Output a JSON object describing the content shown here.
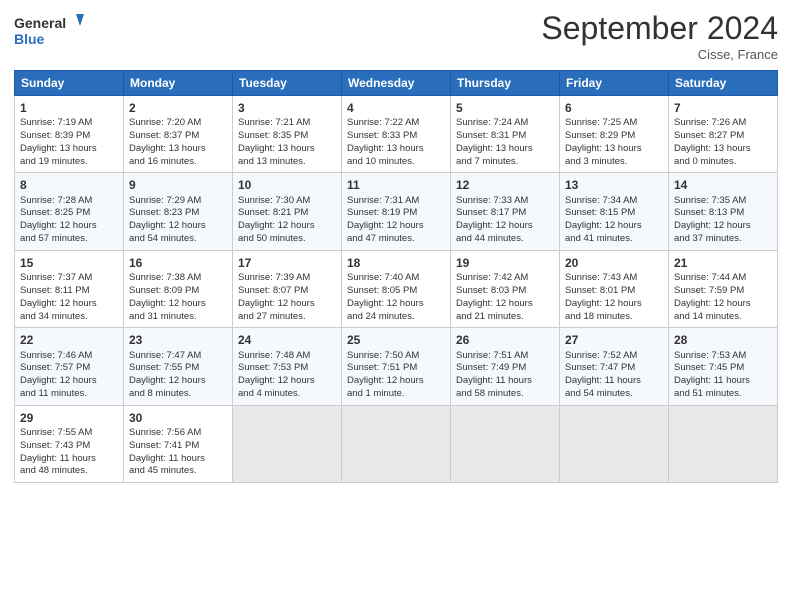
{
  "logo": {
    "line1": "General",
    "line2": "Blue"
  },
  "title": "September 2024",
  "subtitle": "Cisse, France",
  "days_header": [
    "Sunday",
    "Monday",
    "Tuesday",
    "Wednesday",
    "Thursday",
    "Friday",
    "Saturday"
  ],
  "weeks": [
    [
      {
        "num": "1",
        "lines": [
          "Sunrise: 7:19 AM",
          "Sunset: 8:39 PM",
          "Daylight: 13 hours",
          "and 19 minutes."
        ]
      },
      {
        "num": "2",
        "lines": [
          "Sunrise: 7:20 AM",
          "Sunset: 8:37 PM",
          "Daylight: 13 hours",
          "and 16 minutes."
        ]
      },
      {
        "num": "3",
        "lines": [
          "Sunrise: 7:21 AM",
          "Sunset: 8:35 PM",
          "Daylight: 13 hours",
          "and 13 minutes."
        ]
      },
      {
        "num": "4",
        "lines": [
          "Sunrise: 7:22 AM",
          "Sunset: 8:33 PM",
          "Daylight: 13 hours",
          "and 10 minutes."
        ]
      },
      {
        "num": "5",
        "lines": [
          "Sunrise: 7:24 AM",
          "Sunset: 8:31 PM",
          "Daylight: 13 hours",
          "and 7 minutes."
        ]
      },
      {
        "num": "6",
        "lines": [
          "Sunrise: 7:25 AM",
          "Sunset: 8:29 PM",
          "Daylight: 13 hours",
          "and 3 minutes."
        ]
      },
      {
        "num": "7",
        "lines": [
          "Sunrise: 7:26 AM",
          "Sunset: 8:27 PM",
          "Daylight: 13 hours",
          "and 0 minutes."
        ]
      }
    ],
    [
      {
        "num": "8",
        "lines": [
          "Sunrise: 7:28 AM",
          "Sunset: 8:25 PM",
          "Daylight: 12 hours",
          "and 57 minutes."
        ]
      },
      {
        "num": "9",
        "lines": [
          "Sunrise: 7:29 AM",
          "Sunset: 8:23 PM",
          "Daylight: 12 hours",
          "and 54 minutes."
        ]
      },
      {
        "num": "10",
        "lines": [
          "Sunrise: 7:30 AM",
          "Sunset: 8:21 PM",
          "Daylight: 12 hours",
          "and 50 minutes."
        ]
      },
      {
        "num": "11",
        "lines": [
          "Sunrise: 7:31 AM",
          "Sunset: 8:19 PM",
          "Daylight: 12 hours",
          "and 47 minutes."
        ]
      },
      {
        "num": "12",
        "lines": [
          "Sunrise: 7:33 AM",
          "Sunset: 8:17 PM",
          "Daylight: 12 hours",
          "and 44 minutes."
        ]
      },
      {
        "num": "13",
        "lines": [
          "Sunrise: 7:34 AM",
          "Sunset: 8:15 PM",
          "Daylight: 12 hours",
          "and 41 minutes."
        ]
      },
      {
        "num": "14",
        "lines": [
          "Sunrise: 7:35 AM",
          "Sunset: 8:13 PM",
          "Daylight: 12 hours",
          "and 37 minutes."
        ]
      }
    ],
    [
      {
        "num": "15",
        "lines": [
          "Sunrise: 7:37 AM",
          "Sunset: 8:11 PM",
          "Daylight: 12 hours",
          "and 34 minutes."
        ]
      },
      {
        "num": "16",
        "lines": [
          "Sunrise: 7:38 AM",
          "Sunset: 8:09 PM",
          "Daylight: 12 hours",
          "and 31 minutes."
        ]
      },
      {
        "num": "17",
        "lines": [
          "Sunrise: 7:39 AM",
          "Sunset: 8:07 PM",
          "Daylight: 12 hours",
          "and 27 minutes."
        ]
      },
      {
        "num": "18",
        "lines": [
          "Sunrise: 7:40 AM",
          "Sunset: 8:05 PM",
          "Daylight: 12 hours",
          "and 24 minutes."
        ]
      },
      {
        "num": "19",
        "lines": [
          "Sunrise: 7:42 AM",
          "Sunset: 8:03 PM",
          "Daylight: 12 hours",
          "and 21 minutes."
        ]
      },
      {
        "num": "20",
        "lines": [
          "Sunrise: 7:43 AM",
          "Sunset: 8:01 PM",
          "Daylight: 12 hours",
          "and 18 minutes."
        ]
      },
      {
        "num": "21",
        "lines": [
          "Sunrise: 7:44 AM",
          "Sunset: 7:59 PM",
          "Daylight: 12 hours",
          "and 14 minutes."
        ]
      }
    ],
    [
      {
        "num": "22",
        "lines": [
          "Sunrise: 7:46 AM",
          "Sunset: 7:57 PM",
          "Daylight: 12 hours",
          "and 11 minutes."
        ]
      },
      {
        "num": "23",
        "lines": [
          "Sunrise: 7:47 AM",
          "Sunset: 7:55 PM",
          "Daylight: 12 hours",
          "and 8 minutes."
        ]
      },
      {
        "num": "24",
        "lines": [
          "Sunrise: 7:48 AM",
          "Sunset: 7:53 PM",
          "Daylight: 12 hours",
          "and 4 minutes."
        ]
      },
      {
        "num": "25",
        "lines": [
          "Sunrise: 7:50 AM",
          "Sunset: 7:51 PM",
          "Daylight: 12 hours",
          "and 1 minute."
        ]
      },
      {
        "num": "26",
        "lines": [
          "Sunrise: 7:51 AM",
          "Sunset: 7:49 PM",
          "Daylight: 11 hours",
          "and 58 minutes."
        ]
      },
      {
        "num": "27",
        "lines": [
          "Sunrise: 7:52 AM",
          "Sunset: 7:47 PM",
          "Daylight: 11 hours",
          "and 54 minutes."
        ]
      },
      {
        "num": "28",
        "lines": [
          "Sunrise: 7:53 AM",
          "Sunset: 7:45 PM",
          "Daylight: 11 hours",
          "and 51 minutes."
        ]
      }
    ],
    [
      {
        "num": "29",
        "lines": [
          "Sunrise: 7:55 AM",
          "Sunset: 7:43 PM",
          "Daylight: 11 hours",
          "and 48 minutes."
        ]
      },
      {
        "num": "30",
        "lines": [
          "Sunrise: 7:56 AM",
          "Sunset: 7:41 PM",
          "Daylight: 11 hours",
          "and 45 minutes."
        ]
      },
      null,
      null,
      null,
      null,
      null
    ]
  ]
}
